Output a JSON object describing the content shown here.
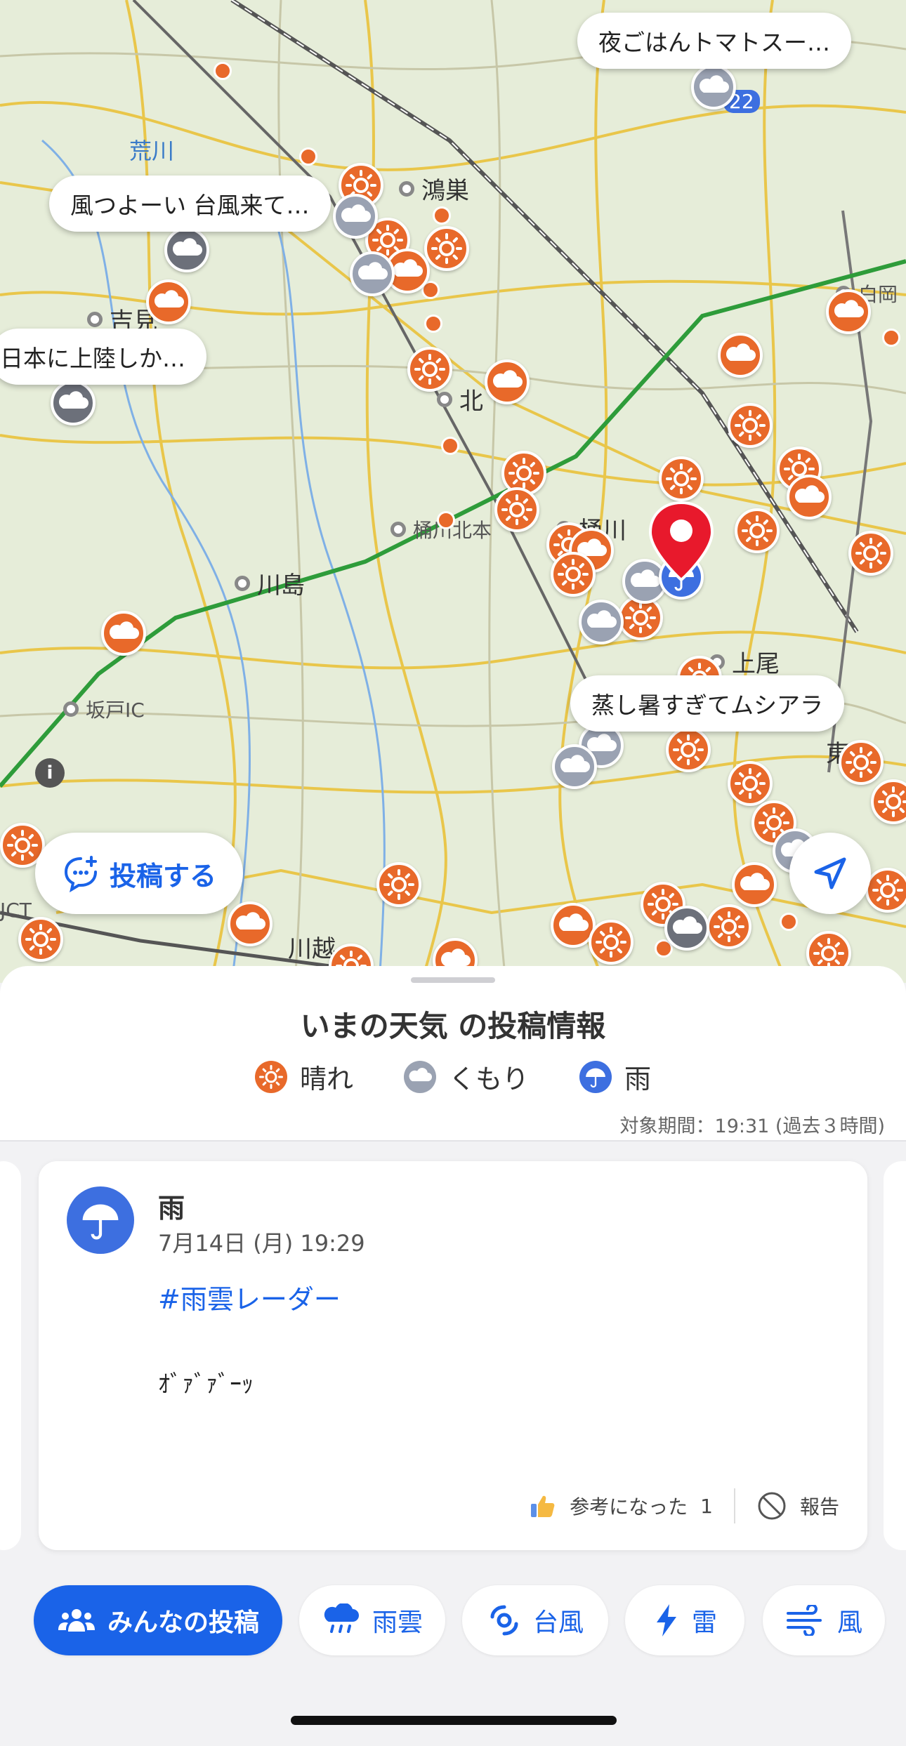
{
  "map": {
    "places": {
      "konosu": "鴻巣",
      "yoshimi": "吉見",
      "kita": "北",
      "okegawa_kita": "桶川北本",
      "okegawa": "桶川",
      "kawajima": "川島",
      "ageo": "上尾",
      "sakado_ic": "坂戸IC",
      "kawagoe": "川越",
      "shiraoka": "白岡",
      "jct": "JCT",
      "higashi": "東",
      "route_number": "22"
    },
    "river": "荒川",
    "bubbles": {
      "b1": "夜ごはんトマトスー…",
      "b2": "風つよーい 台風来て…",
      "b3": "日本に上陸しか…",
      "b4": "蒸し暑すぎてムシアラ"
    },
    "info_label": "i",
    "post_button_label": "投稿する"
  },
  "sheet": {
    "title": "いまの天気 の投稿情報",
    "legend": [
      {
        "label": "晴れ",
        "icon": "sun-icon",
        "color": "#e8692a"
      },
      {
        "label": "くもり",
        "icon": "cloud-icon",
        "color": "#9aa2b2"
      },
      {
        "label": "雨",
        "icon": "umbrella-icon",
        "color": "#3d6fe0"
      }
    ],
    "period": "対象期間：19:31 (過去３時間)"
  },
  "post": {
    "weather": "雨",
    "datetime": "7月14日 (月) 19:29",
    "hashtag": "#雨雲レーダー",
    "body": "ｵﾞｧﾞｧﾞｰｯ",
    "helpful_label": "参考になった",
    "helpful_count": "1",
    "report_label": "報告"
  },
  "tabs": [
    {
      "label": "みんなの投稿",
      "icon": "people-icon",
      "active": true
    },
    {
      "label": "雨雲",
      "icon": "rain-cloud-icon"
    },
    {
      "label": "台風",
      "icon": "typhoon-icon"
    },
    {
      "label": "雷",
      "icon": "lightning-icon"
    },
    {
      "label": "風",
      "icon": "wind-icon"
    }
  ],
  "colors": {
    "accent": "#1a63e8",
    "sunny": "#e8692a",
    "cloudy": "#9aa2b2",
    "rain": "#3d6fe0",
    "pin": "#e8192c"
  }
}
